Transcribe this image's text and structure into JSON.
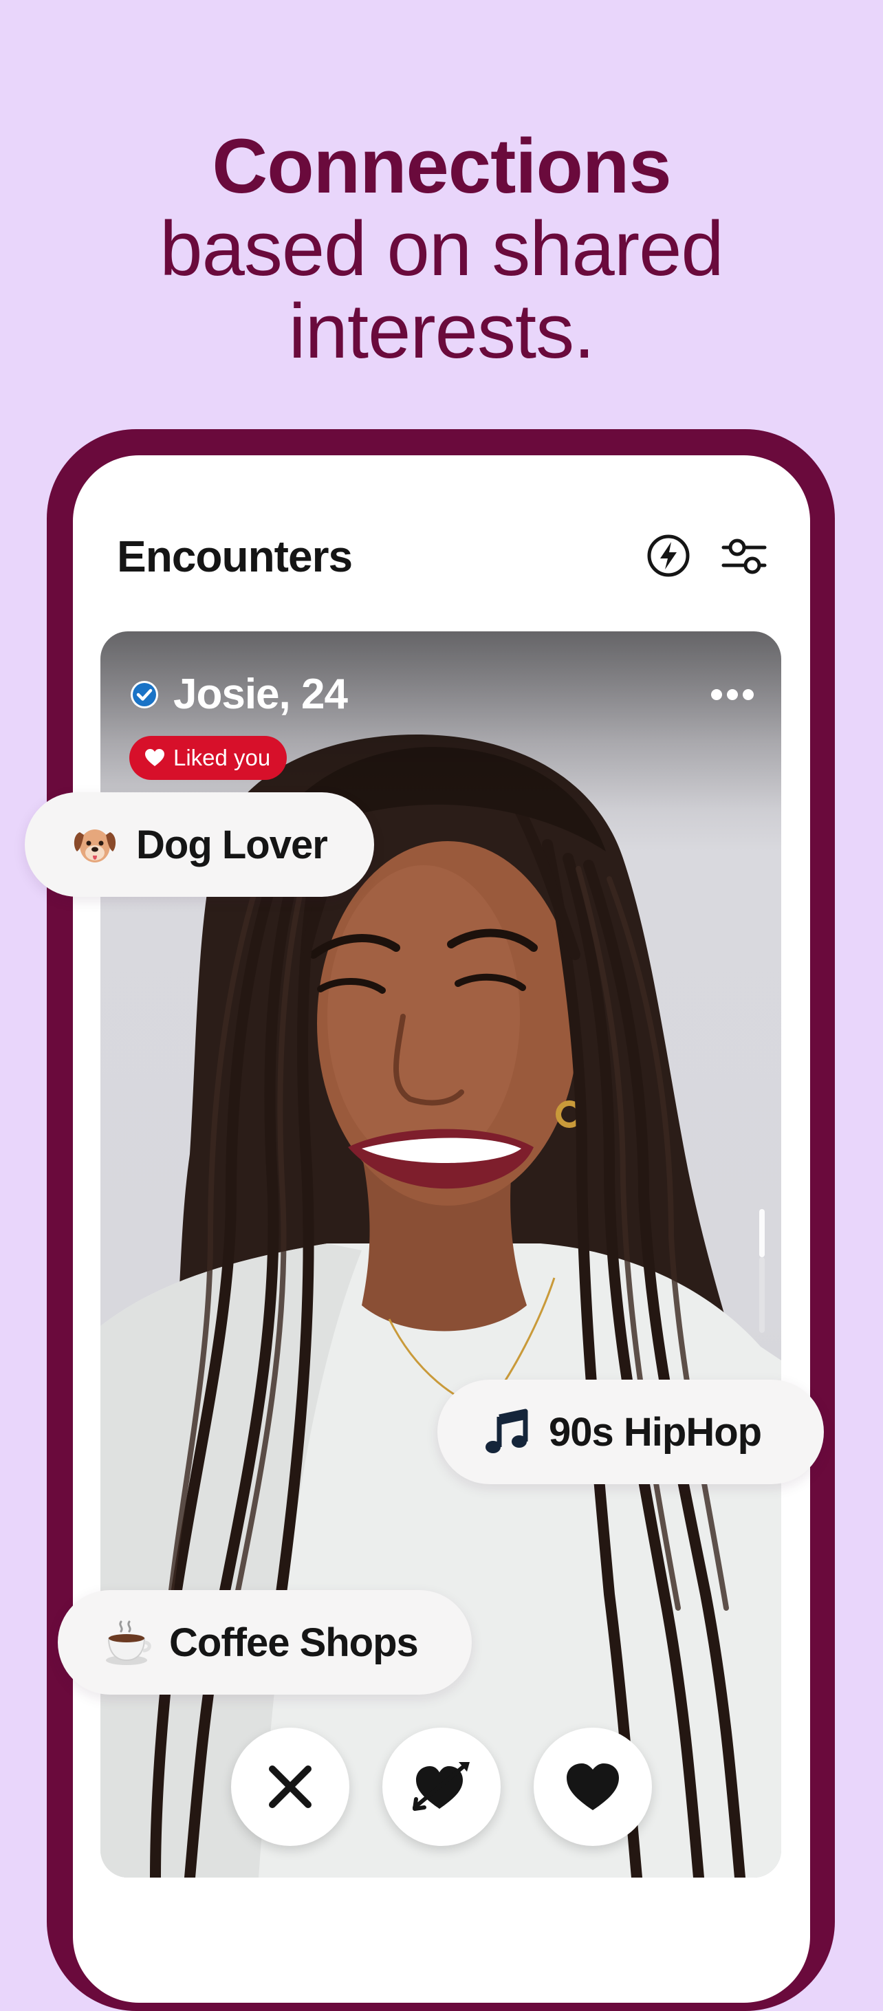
{
  "headline": {
    "bold": "Connections",
    "line2": "based on shared",
    "line3": "interests."
  },
  "header": {
    "title": "Encounters",
    "icons": [
      "lightning-icon",
      "filter-sliders-icon"
    ]
  },
  "profile": {
    "name_age": "Josie, 24",
    "verified": true,
    "badge": "Liked you",
    "photo_description_icon": "profile-photo"
  },
  "interests": [
    {
      "label": "Dog Lover",
      "icon": "dog-face-icon"
    },
    {
      "label": "90s HipHop",
      "icon": "music-note-icon"
    },
    {
      "label": "Coffee Shops",
      "icon": "coffee-cup-icon"
    }
  ],
  "actions": [
    {
      "name": "pass",
      "icon": "close-icon"
    },
    {
      "name": "crush",
      "icon": "heart-arrow-icon"
    },
    {
      "name": "like",
      "icon": "heart-icon"
    }
  ],
  "colors": {
    "background": "#e9d6fb",
    "brand": "#6a0a3c",
    "badge": "#d7102a",
    "verified": "#1a73c6"
  }
}
